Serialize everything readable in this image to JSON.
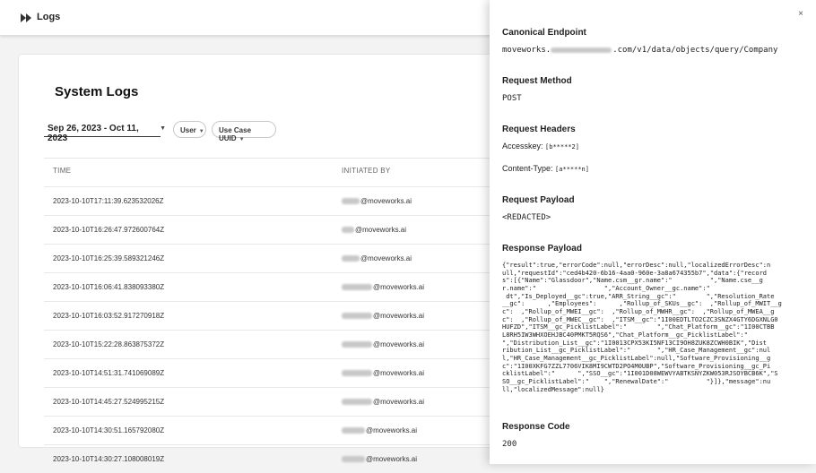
{
  "topbar": {
    "title": "Logs",
    "logo_icon": "fast-forward-icon"
  },
  "page": {
    "title": "System Logs"
  },
  "filters": {
    "date_range": "Sep 26, 2023 - Oct 11, 2023",
    "user_label": "User",
    "use_case_label": "Use Case UUID"
  },
  "table": {
    "headers": {
      "time": "TIME",
      "initiated_by": "INITIATED BY"
    },
    "rows": [
      {
        "time": "2023-10-10T17:11:39.623532026Z",
        "user": "@moveworks.ai"
      },
      {
        "time": "2023-10-10T16:26:47.972600764Z",
        "user": "@moveworks.ai"
      },
      {
        "time": "2023-10-10T16:25:39.589321246Z",
        "user": "@moveworks.ai"
      },
      {
        "time": "2023-10-10T16:06:41.838093380Z",
        "user": "@moveworks.ai"
      },
      {
        "time": "2023-10-10T16:03:52.917270918Z",
        "user": "@moveworks.ai"
      },
      {
        "time": "2023-10-10T15:22:28.863875372Z",
        "user": "@moveworks.ai"
      },
      {
        "time": "2023-10-10T14:51:31.741069089Z",
        "user": "@moveworks.ai"
      },
      {
        "time": "2023-10-10T14:45:27.524995215Z",
        "user": "@moveworks.ai"
      },
      {
        "time": "2023-10-10T14:30:51.165792080Z",
        "user": "@moveworks.ai"
      },
      {
        "time": "2023-10-10T14:30:27.108008019Z",
        "user": "@moveworks.ai"
      }
    ]
  },
  "panel": {
    "close": "×",
    "canonical_endpoint_title": "Canonical Endpoint",
    "canonical_endpoint_prefix": "moveworks.",
    "canonical_endpoint_suffix": ".com/v1/data/objects/query/Company",
    "request_method_title": "Request Method",
    "request_method": "POST",
    "request_headers_title": "Request Headers",
    "accesskey_label": "Accesskey:",
    "accesskey_value": "[b*****2]",
    "content_type_label": "Content-Type:",
    "content_type_value": "[a*****n]",
    "request_payload_title": "Request Payload",
    "request_payload": "<REDACTED>",
    "response_payload_title": "Response Payload",
    "response_payload": "{\"result\":true,\"errorCode\":null,\"errorDesc\":null,\"localizedErrorDesc\":n\null,\"requestId\":\"ced4b420-6b16-4aa0-960e-3a8a674355b7\",\"data\":{\"record\ns\":[{\"Name\":\"Glassdoor\",\"Name.csm__gr.name\":\"          \",\"Name.cse__g\nr.name\":\"                  \",\"Account_Owner__gc.name\":\"                  \n dt\",\"Is_Deployed__gc\":true,\"ARR_String__gc\":\"        \",\"Resolution_Rate\n__gc\":      ,\"Employees\":      ,\"Rollup_of_SKUs__gc\":  ,\"Rollup_of_MWIT__g\nc\":  ,\"Rollup_of_MWEI__gc\":  ,\"Rollup_of_MWHR__gc\":  ,\"Rollup_of_MWEA__g\nc\":  ,\"Rollup_of_MWEC__gc\":  ,\"ITSM__gc\":\"1I00EDTLTO2CZC3SNZX4GTY6DGXNLG0\nHUFZD\",\"ITSM__gc_PicklistLabel\":\"        \",\"Chat_Platform__gc\":\"1I00CTBB\nL8RH5IW3WHXOEHJBC40PMKT5RQS6\",\"Chat_Platform__gc_PicklistLabel\":\"     \n\",\"Distribution_List__gc\":\"1I0013CPX53KI5NF13CI9OH8ZUK8ZCWH0BIK\",\"Dist\nribution_List__gc_PicklistLabel\":\"       \",\"HR_Case_Management__gc\":nul\nl,\"HR_Case_Management__gc_PicklistLabel\":null,\"Software_Provisioning__g\nc\":\"1I00XKFG7ZZL7706VIK8MI9CWTD2PO4M0UBP\",\"Software_Provisioning__gc_Pi\ncklistLabel\":\"      \",\"SSO__gc\":\"1I001D08WEWVYABTKSNYZKW053RJSOYBCB6K\",\"S\nSO__gc_PicklistLabel\":\"    \",\"RenewalDate\":\"          \"}]},\"message\":nu\nll,\"localizedMessage\":null}",
    "response_code_title": "Response Code",
    "response_code": "200"
  }
}
